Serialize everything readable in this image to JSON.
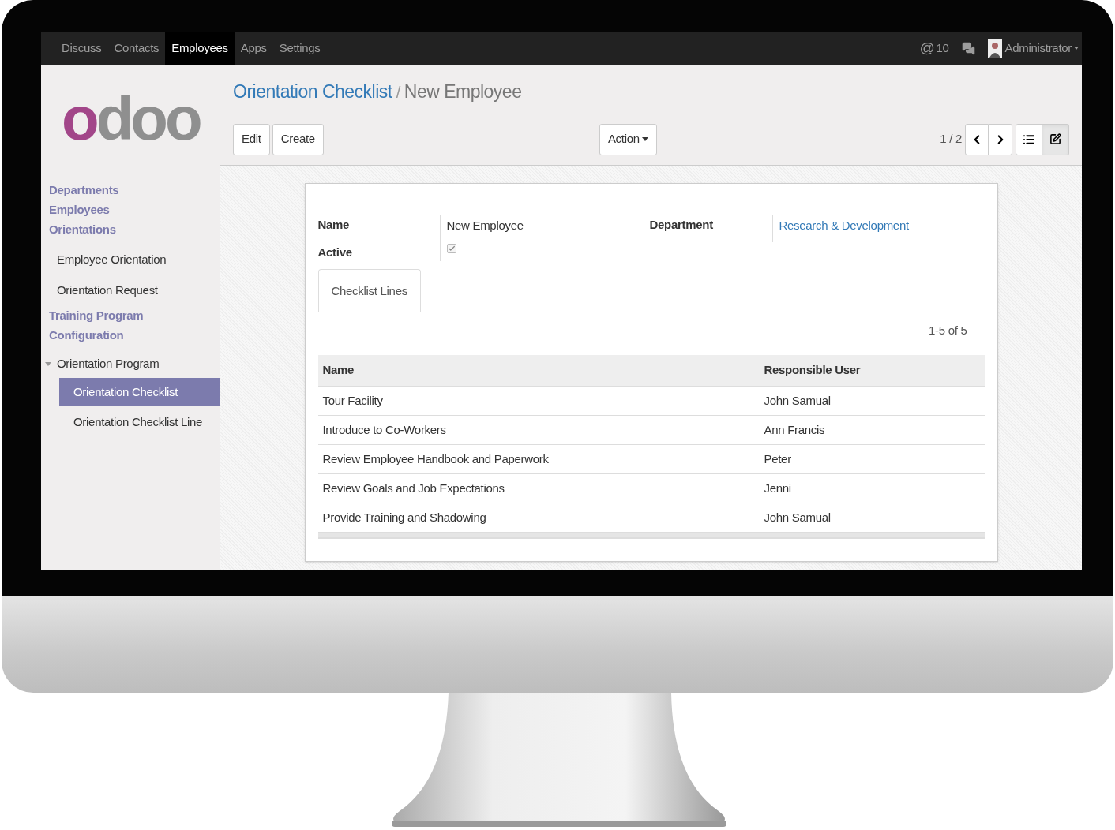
{
  "navbar": {
    "menus": [
      {
        "label": "Discuss",
        "selected": false
      },
      {
        "label": "Contacts",
        "selected": false
      },
      {
        "label": "Employees",
        "selected": true
      },
      {
        "label": "Apps",
        "selected": false
      },
      {
        "label": "Settings",
        "selected": false
      }
    ],
    "mentions": {
      "symbol": "@",
      "count": "10"
    },
    "user": "Administrator"
  },
  "sidebar": {
    "logo": "odoo",
    "items": [
      {
        "kind": "heading",
        "label": "Departments"
      },
      {
        "kind": "heading",
        "label": "Employees"
      },
      {
        "kind": "heading",
        "label": "Orientations"
      },
      {
        "kind": "item",
        "label": "Employee Orientation",
        "selected": false
      },
      {
        "kind": "item",
        "label": "Orientation Request",
        "selected": false
      },
      {
        "kind": "heading",
        "label": "Training Program"
      },
      {
        "kind": "heading",
        "label": "Configuration"
      },
      {
        "kind": "group",
        "label": "Orientation Program",
        "expanded": true
      },
      {
        "kind": "subitem",
        "label": "Orientation Checklist",
        "selected": true
      },
      {
        "kind": "subitem",
        "label": "Orientation Checklist Line",
        "selected": false
      }
    ]
  },
  "breadcrumb": {
    "parent": "Orientation Checklist",
    "separator": "/",
    "current": "New Employee"
  },
  "buttons": [
    "Edit",
    "Create"
  ],
  "action_button": "Action",
  "pager": "1 / 2",
  "views": [
    {
      "kind": "list",
      "selected": false
    },
    {
      "kind": "form",
      "selected": true
    }
  ],
  "form": {
    "name_label": "Name",
    "name": "New Employee",
    "active_label": "Active",
    "active": true,
    "department_label": "Department",
    "department": "Research & Development",
    "tabs": [
      {
        "label": "Checklist Lines",
        "selected": true
      }
    ],
    "lines_pager": "1-5 of 5",
    "table": {
      "columns": [
        "Name",
        "Responsible User"
      ],
      "rows": [
        [
          "Tour Facility",
          "John Samual"
        ],
        [
          "Introduce to Co-Workers",
          "Ann Francis"
        ],
        [
          "Review Employee Handbook and Paperwork",
          "Peter"
        ],
        [
          "Review Goals and Job Expectations",
          "Jenni"
        ],
        [
          "Provide Training and Shadowing",
          "John Samual"
        ]
      ]
    }
  }
}
